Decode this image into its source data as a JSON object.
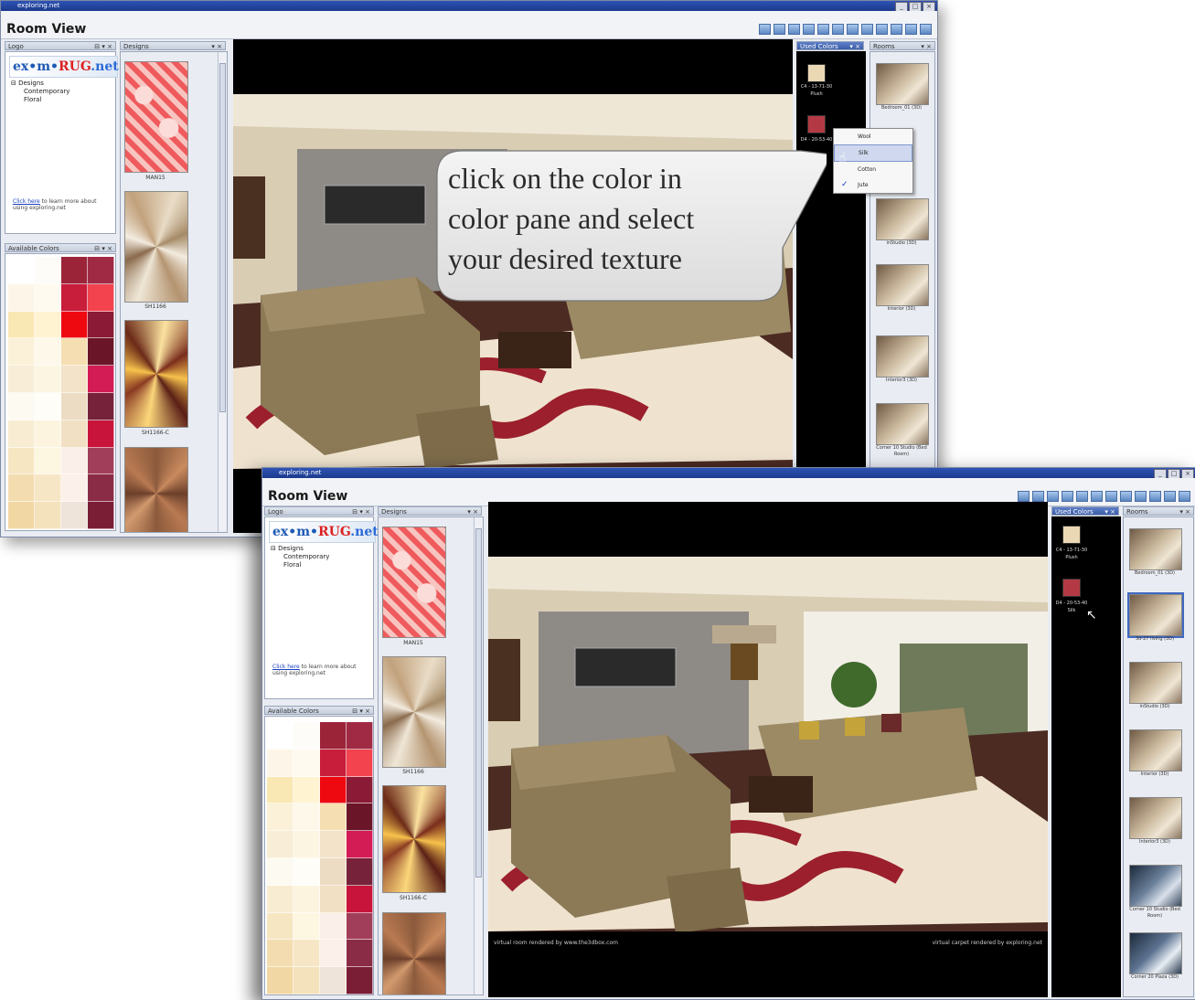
{
  "app": {
    "window_title": "exploring.net",
    "view_title": "Room View"
  },
  "panels": {
    "logo_header": "Logo",
    "logo_text_prefix": "ex•m•",
    "logo_text_rug": "RUG",
    "logo_text_suffix": ".net",
    "designs_header": "Designs",
    "available_colors_header": "Available Colors",
    "used_colors_header": "Used Colors",
    "rooms_header": "Rooms"
  },
  "tree": {
    "root": "Designs",
    "children": [
      "Contemporary",
      "Floral"
    ]
  },
  "note": {
    "link": "Click here",
    "text": "to learn more about using exploring.net"
  },
  "designs": [
    {
      "label": "MAN15"
    },
    {
      "label": "SH1166"
    },
    {
      "label": "SH1166-C"
    }
  ],
  "used_colors": [
    {
      "code": "C4 - 13-71-30",
      "texture": "Plush",
      "color": "#ead8b4"
    },
    {
      "code": "D4 - 20-53-40",
      "texture": "Silk",
      "color": "#b33a45"
    }
  ],
  "texture_menu": {
    "items": [
      {
        "label": "Wool",
        "checked": false,
        "highlighted": false
      },
      {
        "label": "Silk",
        "checked": false,
        "highlighted": true
      },
      {
        "label": "Cotton",
        "checked": false,
        "highlighted": false
      },
      {
        "label": "Jute",
        "checked": true,
        "highlighted": false
      }
    ]
  },
  "rooms": [
    {
      "label": "Bedroom_01 (3D)"
    },
    {
      "label": "3d-27 living (3D)"
    },
    {
      "label": "inStudio (3D)"
    },
    {
      "label": "Interior (3D)"
    },
    {
      "label": "Interior3 (3D)"
    },
    {
      "label": "Corner 10 Studio (Bed Room)"
    },
    {
      "label": "Corner 20 Plaza (3D)"
    }
  ],
  "viewer": {
    "credit_left": "virtual room rendered by www.the3dbox.com",
    "credit_right": "virtual carpet rendered by exploring.net"
  },
  "callout": {
    "line1": "click on the color in",
    "line2": "color pane and select",
    "line3": "your desired texture"
  },
  "palette_colors": [
    "#ffffff",
    "#fdfcf8",
    "#9c2439",
    "#a02a44",
    "#fdf6e8",
    "#fffaf0",
    "#c81d3b",
    "#f2434f",
    "#f9e8b4",
    "#fff3d2",
    "#ee0810",
    "#8a1a35",
    "#fbf1d8",
    "#fdf8ea",
    "#f5dfb2",
    "#6b1528",
    "#f8edd6",
    "#fcf5e2",
    "#f3e3c9",
    "#d31b55",
    "#fdfaf2",
    "#fefdf7",
    "#eddcc4",
    "#76223a",
    "#f8ecd2",
    "#fcf4df",
    "#f2e0c4",
    "#c8143a",
    "#f6e6c2",
    "#fdf6e0",
    "#fbefe9",
    "#a13f5a",
    "#f3ddb0",
    "#f7e6c6",
    "#fbf0ea",
    "#8b2c46",
    "#f1d7a3",
    "#f4e2bc",
    "#efe4d9",
    "#7a1e36"
  ]
}
